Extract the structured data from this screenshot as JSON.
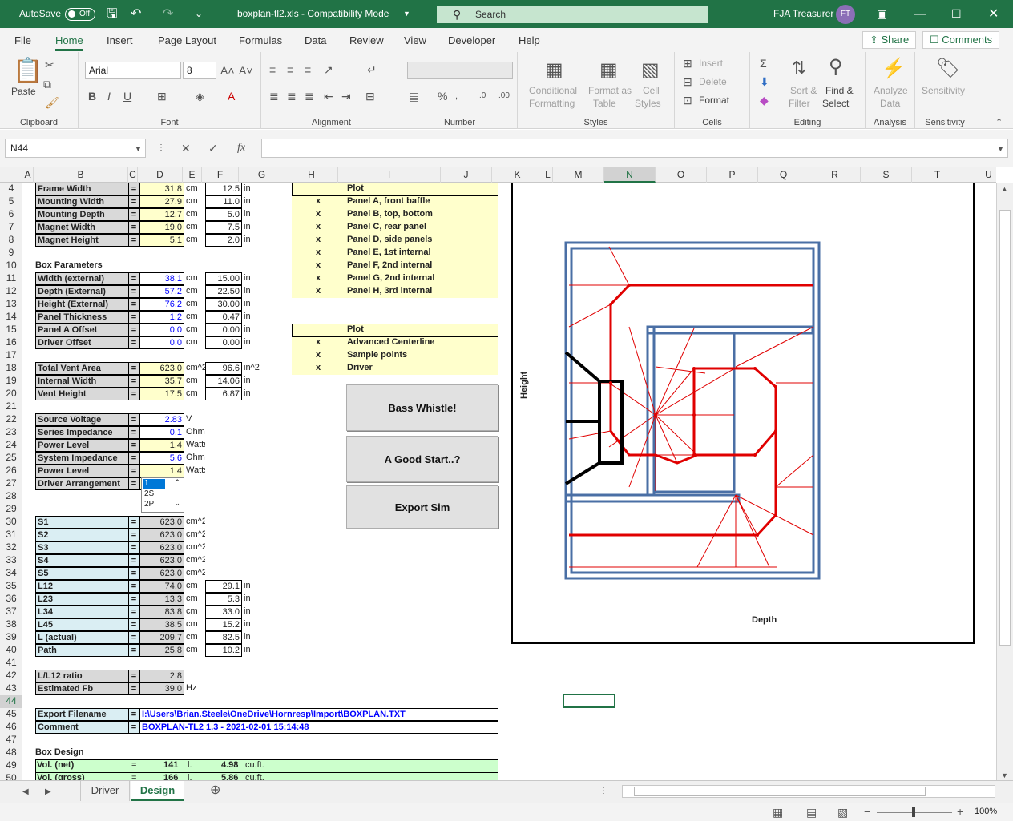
{
  "titlebar": {
    "autosave": "AutoSave",
    "autosave_state": "Off",
    "doc": "boxplan-tl2.xls  -  Compatibility Mode",
    "search": "Search",
    "user": "FJA Treasurer",
    "initials": "FT"
  },
  "tabs": [
    "File",
    "Home",
    "Insert",
    "Page Layout",
    "Formulas",
    "Data",
    "Review",
    "View",
    "Developer",
    "Help"
  ],
  "share": "Share",
  "comments": "Comments",
  "ribbon": {
    "clipboard": {
      "paste": "Paste",
      "label": "Clipboard"
    },
    "font": {
      "name": "Arial",
      "size": "8",
      "label": "Font"
    },
    "alignment": {
      "label": "Alignment"
    },
    "number": {
      "label": "Number"
    },
    "styles": {
      "cond1": "Conditional",
      "cond2": "Formatting",
      "fmt1": "Format as",
      "fmt2": "Table",
      "cell1": "Cell",
      "cell2": "Styles",
      "label": "Styles"
    },
    "cells": {
      "insert": "Insert",
      "delete": "Delete",
      "format": "Format",
      "label": "Cells"
    },
    "editing": {
      "sort1": "Sort &",
      "sort2": "Filter",
      "find1": "Find &",
      "find2": "Select",
      "label": "Editing"
    },
    "analysis": {
      "a1": "Analyze",
      "a2": "Data",
      "label": "Analysis"
    },
    "sensitivity": {
      "s1": "Sensitivity",
      "label": "Sensitivity"
    }
  },
  "namebox": "N44",
  "fx": "fx",
  "columns": [
    "A",
    "B",
    "C",
    "D",
    "E",
    "F",
    "G",
    "H",
    "I",
    "J",
    "K",
    "L",
    "M",
    "N",
    "O",
    "P",
    "Q",
    "R",
    "S",
    "T",
    "U"
  ],
  "rows": [
    "4",
    "5",
    "6",
    "7",
    "8",
    "9",
    "10",
    "11",
    "12",
    "13",
    "14",
    "15",
    "16",
    "17",
    "18",
    "19",
    "20",
    "21",
    "22",
    "23",
    "24",
    "25",
    "26",
    "27",
    "28",
    "29",
    "30",
    "31",
    "32",
    "33",
    "34",
    "35",
    "36",
    "37",
    "38",
    "39",
    "40",
    "41",
    "42",
    "43",
    "44",
    "45",
    "46",
    "47",
    "48",
    "49",
    "50"
  ],
  "params": [
    {
      "label": "Frame Width",
      "val": "31.8",
      "u": "cm",
      "val2": "12.5",
      "u2": "in"
    },
    {
      "label": "Mounting Width",
      "val": "27.9",
      "u": "cm",
      "val2": "11.0",
      "u2": "in"
    },
    {
      "label": "Mounting Depth",
      "val": "12.7",
      "u": "cm",
      "val2": "5.0",
      "u2": "in"
    },
    {
      "label": "Magnet Width",
      "val": "19.0",
      "u": "cm",
      "val2": "7.5",
      "u2": "in"
    },
    {
      "label": "Magnet Height",
      "val": "5.1",
      "u": "cm",
      "val2": "2.0",
      "u2": "in"
    }
  ],
  "box_title": "Box Parameters",
  "box": [
    {
      "label": "Width (external)",
      "val": "38.1",
      "u": "cm",
      "val2": "15.00",
      "u2": "in"
    },
    {
      "label": "Depth (External)",
      "val": "57.2",
      "u": "cm",
      "val2": "22.50",
      "u2": "in"
    },
    {
      "label": "Height (External)",
      "val": "76.2",
      "u": "cm",
      "val2": "30.00",
      "u2": "in"
    },
    {
      "label": "Panel Thickness",
      "val": "1.2",
      "u": "cm",
      "val2": "0.47",
      "u2": "in"
    },
    {
      "label": "Panel A Offset",
      "val": "0.0",
      "u": "cm",
      "val2": "0.00",
      "u2": "in"
    },
    {
      "label": "Driver Offset",
      "val": "0.0",
      "u": "cm",
      "val2": "0.00",
      "u2": "in"
    }
  ],
  "vent": [
    {
      "label": "Total Vent Area",
      "val": "623.0",
      "u": "cm^2",
      "val2": "96.6",
      "u2": "in^2"
    },
    {
      "label": "Internal Width",
      "val": "35.7",
      "u": "cm",
      "val2": "14.06",
      "u2": "in"
    },
    {
      "label": "Vent Height",
      "val": "17.5",
      "u": "cm",
      "val2": "6.87",
      "u2": "in"
    }
  ],
  "power": [
    {
      "label": "Source Voltage",
      "val": "2.83",
      "u": "V",
      "blue": true
    },
    {
      "label": "Series Impedance",
      "val": "0.1",
      "u": "Ohms",
      "blue": true
    },
    {
      "label": "Power Level",
      "val": "1.4",
      "u": "Watts",
      "blue": false
    },
    {
      "label": "System Impedance",
      "val": "5.6",
      "u": "Ohms",
      "blue": true
    },
    {
      "label": "Power Level",
      "val": "1.4",
      "u": "Watts",
      "blue": false
    },
    {
      "label": "Driver Arrangement",
      "val": "",
      "u": "",
      "blue": false
    }
  ],
  "dropdown": [
    "1",
    "2S",
    "2P"
  ],
  "sections": [
    {
      "label": "S1",
      "val": "623.0",
      "u": "cm^2"
    },
    {
      "label": "S2",
      "val": "623.0",
      "u": "cm^2"
    },
    {
      "label": "S3",
      "val": "623.0",
      "u": "cm^2"
    },
    {
      "label": "S4",
      "val": "623.0",
      "u": "cm^2"
    },
    {
      "label": "S5",
      "val": "623.0",
      "u": "cm^2"
    }
  ],
  "lengths": [
    {
      "label": "L12",
      "val": "74.0",
      "u": "cm",
      "val2": "29.1",
      "u2": "in"
    },
    {
      "label": "L23",
      "val": "13.3",
      "u": "cm",
      "val2": "5.3",
      "u2": "in"
    },
    {
      "label": "L34",
      "val": "83.8",
      "u": "cm",
      "val2": "33.0",
      "u2": "in"
    },
    {
      "label": "L45",
      "val": "38.5",
      "u": "cm",
      "val2": "15.2",
      "u2": "in"
    },
    {
      "label": "L (actual)",
      "val": "209.7",
      "u": "cm",
      "val2": "82.5",
      "u2": "in"
    },
    {
      "label": "Path",
      "val": "25.8",
      "u": "cm",
      "val2": "10.2",
      "u2": "in"
    }
  ],
  "ratio": [
    {
      "label": "L/L12 ratio",
      "val": "2.8",
      "u": ""
    },
    {
      "label": "Estimated Fb",
      "val": "39.0",
      "u": "Hz"
    }
  ],
  "export": {
    "label1": "Export Filename",
    "val1": "I:\\Users\\Brian.Steele\\OneDrive\\Hornresp\\Import\\BOXPLAN.TXT",
    "label2": "Comment",
    "val2": "BOXPLAN-TL2 1.3 - 2021-02-01 15:14:48"
  },
  "design": {
    "title": "Box Design",
    "r1": [
      "Vol. (net)",
      "=",
      "141",
      "l.",
      "4.98",
      "cu.ft."
    ],
    "r2": [
      "Vol. (gross)",
      "=",
      "166",
      "l.",
      "5.86",
      "cu.ft."
    ]
  },
  "plot1": {
    "title": "Plot",
    "items": [
      "Panel A, front baffle",
      "Panel B, top, bottom",
      "Panel C, rear panel",
      "Panel D, side panels",
      "Panel E, 1st internal",
      "Panel F, 2nd internal",
      "Panel G, 2nd internal",
      "Panel H, 3rd internal"
    ],
    "mark": "x"
  },
  "plot2": {
    "title": "Plot",
    "items": [
      "Advanced Centerline",
      "Sample points",
      "Driver"
    ],
    "mark": "x"
  },
  "buttons": [
    "Bass Whistle!",
    "A Good Start..?",
    "Export Sim"
  ],
  "chart": {
    "ylabel": "Height",
    "xlabel": "Depth"
  },
  "sheets": [
    "Driver",
    "Design"
  ],
  "zoom": "100%"
}
